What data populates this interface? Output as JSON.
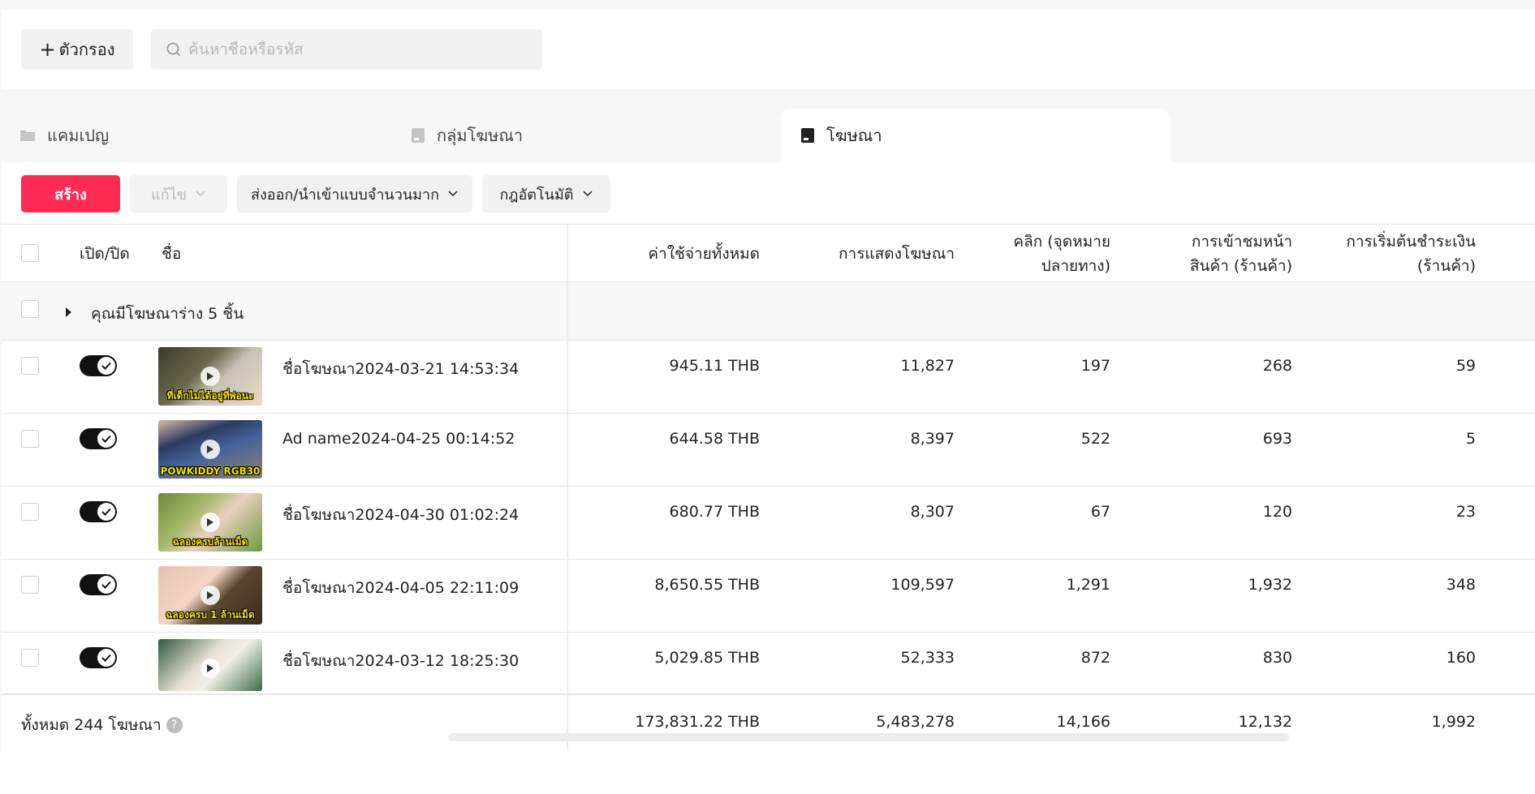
{
  "filter": {
    "add_filter_label": "ตัวกรอง",
    "search_placeholder": "ค้นหาชื่อหรือรหัส"
  },
  "tabs": [
    {
      "label": "แคมเปญ",
      "icon": "folder-icon"
    },
    {
      "label": "กลุ่มโฆษณา",
      "icon": "ad-group-icon"
    },
    {
      "label": "โฆษณา",
      "icon": "ad-icon",
      "active": true
    }
  ],
  "toolbar": {
    "create_label": "สร้าง",
    "edit_label": "แก้ไข",
    "bulk_label": "ส่งออก/นำเข้าแบบจำนวนมาก",
    "rules_label": "กฎอัตโนมัติ"
  },
  "table": {
    "headers": {
      "onoff": "เปิด/ปิด",
      "name": "ชื่อ",
      "spend": "ค่าใช้จ่ายทั้งหมด",
      "impressions": "การแสดงโฆษณา",
      "clicks_l1": "คลิก (จุดหมาย",
      "clicks_l2": "ปลายทาง)",
      "pageviews_l1": "การเข้าชมหน้า",
      "pageviews_l2": "สินค้า (ร้านค้า)",
      "checkout_l1": "การเริ่มต้นชำระเงิน",
      "checkout_l2": "(ร้านค้า)"
    },
    "draft_note": "คุณมีโฆษณาร่าง 5 ชิ้น",
    "rows": [
      {
        "name": "ชื่อโฆษณา2024-03-21 14:53:34",
        "spend": "945.11 THB",
        "impressions": "11,827",
        "clicks": "197",
        "pageviews": "268",
        "checkout": "59",
        "thumb_caption": "ที่เด็กไม่ได้อยู่ที่พ่อนะ"
      },
      {
        "name": "Ad name2024-04-25 00:14:52",
        "spend": "644.58 THB",
        "impressions": "8,397",
        "clicks": "522",
        "pageviews": "693",
        "checkout": "5",
        "thumb_caption": "POWKIDDY RGB30"
      },
      {
        "name": "ชื่อโฆษณา2024-04-30 01:02:24",
        "spend": "680.77 THB",
        "impressions": "8,307",
        "clicks": "67",
        "pageviews": "120",
        "checkout": "23",
        "thumb_caption": "ฉลองครบล้านเม็ด"
      },
      {
        "name": "ชื่อโฆษณา2024-04-05 22:11:09",
        "spend": "8,650.55 THB",
        "impressions": "109,597",
        "clicks": "1,291",
        "pageviews": "1,932",
        "checkout": "348",
        "thumb_caption": "ฉลองครบ 1 ล้านเม็ด"
      },
      {
        "name": "ชื่อโฆษณา2024-03-12 18:25:30",
        "spend": "5,029.85 THB",
        "impressions": "52,333",
        "clicks": "872",
        "pageviews": "830",
        "checkout": "160",
        "thumb_caption": ""
      }
    ],
    "total": {
      "label": "ทั้งหมด 244 โฆษณา",
      "spend": "173,831.22 THB",
      "impressions": "5,483,278",
      "clicks": "14,166",
      "pageviews": "12,132",
      "checkout": "1,992"
    }
  },
  "colors": {
    "accent": "#fe2c55",
    "toggle_on": "#111111"
  }
}
